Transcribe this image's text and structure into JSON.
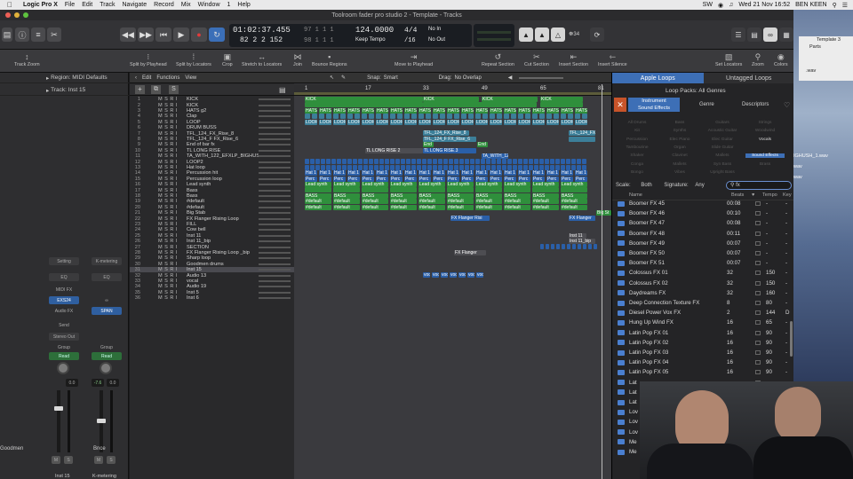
{
  "menubar": {
    "app": "Logic Pro X",
    "items": [
      "File",
      "Edit",
      "Track",
      "Navigate",
      "Record",
      "Mix",
      "Window",
      "1",
      "Help"
    ],
    "right": [
      "SW",
      "Wed 21 Nov 16:52",
      "BEN KEEN"
    ]
  },
  "window": {
    "title": "Toolroom fader pro studio 2 - Template - Tracks"
  },
  "lcd": {
    "time": "01:02:37.455",
    "time_sub": [
      "97",
      "1",
      "1",
      "1"
    ],
    "bars": "82  2  2  152",
    "bars_sub": [
      "98",
      "1",
      "1",
      "1"
    ],
    "tempo": "124.0000",
    "tempo_label": "Keep Tempo",
    "sig_top": "4/4",
    "sig_bottom": "/16",
    "in": "No In",
    "out": "No Out",
    "count": "☸34"
  },
  "toolbar": {
    "items": [
      "Track Zoom",
      "Split by Playhead",
      "Split by Locators",
      "Crop",
      "Stretch to Locators",
      "Join",
      "Bounce Regions",
      "Move to Playhead",
      "Repeat Section",
      "Cut Section",
      "Insert Section",
      "Insert Silence",
      "Set Locators",
      "Zoom",
      "Colors"
    ]
  },
  "inspector": {
    "region": "Region: MIDI Defaults",
    "track": "Track: Inst 15",
    "strip1": {
      "setting": "Setting",
      "eq": "EQ",
      "midi_fx": "MIDI FX",
      "instrument": "EXS24",
      "audio_fx": "Audio FX",
      "send": "Send",
      "output": "Stereo Out",
      "group": "Group",
      "mode": "Read",
      "value": "0.0",
      "name": "Goodmen",
      "name2": "Inst 15",
      "m": "M",
      "s": "S"
    },
    "strip2": {
      "setting": "K-metering",
      "eq": "EQ",
      "link": "∞",
      "span": "SPAN",
      "group": "Group",
      "mode": "Read",
      "value": "-7.6",
      "value2": "0.0",
      "name": "Bnce",
      "name2": "K-metering",
      "m": "M",
      "s": "S"
    }
  },
  "tracks_header": {
    "edit": "Edit",
    "functions": "Functions",
    "view": "View"
  },
  "tracks": [
    {
      "n": "1",
      "name": "KICK"
    },
    {
      "n": "2",
      "name": "KICK"
    },
    {
      "n": "3",
      "name": "HATS g2"
    },
    {
      "n": "4",
      "name": "Clap"
    },
    {
      "n": "5",
      "name": "LOOP"
    },
    {
      "n": "6",
      "name": "DRUM BUSS"
    },
    {
      "n": "7",
      "name": "TFL_124_FX_Rise_8"
    },
    {
      "n": "8",
      "name": "TFL_124_F FX_Rise_6"
    },
    {
      "n": "9",
      "name": "End of bar fx"
    },
    {
      "n": "10",
      "name": "TL LONG RISE"
    },
    {
      "n": "11",
      "name": "TA_WITH_122_EFXLP_BIGHUSH_1"
    },
    {
      "n": "12",
      "name": "LOOP2"
    },
    {
      "n": "13",
      "name": "Hat loop"
    },
    {
      "n": "14",
      "name": "Percussion hit"
    },
    {
      "n": "15",
      "name": "Percussion loop"
    },
    {
      "n": "16",
      "name": "Lead synth"
    },
    {
      "n": "17",
      "name": "Bass"
    },
    {
      "n": "18",
      "name": "Bass"
    },
    {
      "n": "19",
      "name": "#default"
    },
    {
      "n": "20",
      "name": "#default"
    },
    {
      "n": "21",
      "name": "Big Stab"
    },
    {
      "n": "22",
      "name": "FX Flanger Rising Loop"
    },
    {
      "n": "23",
      "name": "FILL"
    },
    {
      "n": "24",
      "name": "Cow bell"
    },
    {
      "n": "25",
      "name": "Inst 11"
    },
    {
      "n": "26",
      "name": "Inst 11_bip"
    },
    {
      "n": "27",
      "name": "SECTION"
    },
    {
      "n": "28",
      "name": "FX Flanger Rising Loop _bip"
    },
    {
      "n": "29",
      "name": "Sharp loop"
    },
    {
      "n": "30",
      "name": "Goodmen drums"
    },
    {
      "n": "31",
      "name": "Inst 15"
    },
    {
      "n": "32",
      "name": "Audio 13"
    },
    {
      "n": "33",
      "name": "vocal"
    },
    {
      "n": "34",
      "name": "Audio 19"
    },
    {
      "n": "35",
      "name": "Inst 5"
    },
    {
      "n": "36",
      "name": "Inst 6"
    }
  ],
  "arrange": {
    "snap_label": "Snap:",
    "snap": "Smart",
    "drag_label": "Drag:",
    "drag": "No Overlap",
    "ruler": [
      "1",
      "17",
      "33",
      "49",
      "65",
      "81"
    ],
    "regions": {
      "kick": "KICK",
      "hats": "HATS g2",
      "loop": "LOOP",
      "rise8": "TFL_124_FX_Rise_8",
      "rise6": "TFL_124_F FX_Rise_6",
      "end": "End",
      "longrise": "TL LONG RISE 2",
      "longrise3": "TL LONG RISE.3",
      "withbig": "TA_WITH_12",
      "hat": "Hat 1",
      "perc": "Perc",
      "lead": "Lead synth",
      "bass": "BASS",
      "def": "#default",
      "bigstab": "Big St",
      "flanger": "FX Flanger Risi",
      "flanger2": "FX Flanger",
      "inst11": "Inst 11",
      "inst11bip": "Inst 11_bip",
      "fxflanger": "FX Flanger",
      "vocal": "voc"
    }
  },
  "browser": {
    "tabs": [
      "Apple Loops",
      "Untagged Loops"
    ],
    "loop_packs_label": "Loop Packs:",
    "loop_packs": "All Genres",
    "instrument": "Instrument",
    "instrument_val": "Sound Effects",
    "genre": "Genre",
    "descriptors": "Descriptors",
    "keywords": [
      "All Drums",
      "Bass",
      "Guitars",
      "Strings",
      "Kit",
      "Synths",
      "Acoustic Guitar",
      "Woodwind",
      "Percussion",
      "Elec Piano",
      "Elec Guitar",
      "Vocals",
      "Tambourine",
      "Organ",
      "Slide Guitar",
      "",
      "Shaker",
      "Clavinet",
      "Mallets",
      "Sound Effects",
      "Conga",
      "Mallets",
      "Syn Bass",
      "Brass",
      "Bongo",
      "Vibes",
      "Upright Bass",
      ""
    ],
    "scale_label": "Scale:",
    "scale": "Both",
    "sig_label": "Signature:",
    "sig": "Any",
    "search": "fx",
    "cols": [
      "Name",
      "Beats",
      "♥",
      "Tempo",
      "Key"
    ],
    "loops": [
      {
        "name": "Boomer FX 45",
        "beats": "00:08",
        "tempo": "-",
        "key": "-"
      },
      {
        "name": "Boomer FX 46",
        "beats": "00:10",
        "tempo": "-",
        "key": "-"
      },
      {
        "name": "Boomer FX 47",
        "beats": "00:08",
        "tempo": "-",
        "key": "-"
      },
      {
        "name": "Boomer FX 48",
        "beats": "00:11",
        "tempo": "-",
        "key": "-"
      },
      {
        "name": "Boomer FX 49",
        "beats": "00:07",
        "tempo": "-",
        "key": "-"
      },
      {
        "name": "Boomer FX 50",
        "beats": "00:07",
        "tempo": "-",
        "key": "-"
      },
      {
        "name": "Boomer FX 51",
        "beats": "00:07",
        "tempo": "-",
        "key": "-"
      },
      {
        "name": "Colossus FX 01",
        "beats": "32",
        "tempo": "150",
        "key": "-"
      },
      {
        "name": "Colossus FX 02",
        "beats": "32",
        "tempo": "150",
        "key": "-"
      },
      {
        "name": "Daydreams FX",
        "beats": "32",
        "tempo": "160",
        "key": "-"
      },
      {
        "name": "Deep Connection Texture FX",
        "beats": "8",
        "tempo": "80",
        "key": "-"
      },
      {
        "name": "Diesel Power Vox FX",
        "beats": "2",
        "tempo": "144",
        "key": "D"
      },
      {
        "name": "Hung Up Wind FX",
        "beats": "16",
        "tempo": "65",
        "key": "-"
      },
      {
        "name": "Latin Pop FX 01",
        "beats": "16",
        "tempo": "90",
        "key": "-"
      },
      {
        "name": "Latin Pop FX 02",
        "beats": "16",
        "tempo": "90",
        "key": "-"
      },
      {
        "name": "Latin Pop FX 03",
        "beats": "16",
        "tempo": "90",
        "key": "-"
      },
      {
        "name": "Latin Pop FX 04",
        "beats": "16",
        "tempo": "90",
        "key": "-"
      },
      {
        "name": "Latin Pop FX 05",
        "beats": "16",
        "tempo": "90",
        "key": "-"
      },
      {
        "name": "Lat",
        "beats": "",
        "tempo": "",
        "key": ""
      },
      {
        "name": "Lat",
        "beats": "",
        "tempo": "",
        "key": ""
      },
      {
        "name": "Lat",
        "beats": "",
        "tempo": "",
        "key": ""
      },
      {
        "name": "Lov",
        "beats": "",
        "tempo": "",
        "key": ""
      },
      {
        "name": "Lov",
        "beats": "",
        "tempo": "",
        "key": ""
      },
      {
        "name": "Lov",
        "beats": "",
        "tempo": "",
        "key": ""
      },
      {
        "name": "Me",
        "beats": "",
        "tempo": "",
        "key": ""
      },
      {
        "name": "Me",
        "beats": "",
        "tempo": "",
        "key": ""
      }
    ]
  },
  "desktop": {
    "files": [
      "Template 3",
      "Parts",
      ".wav",
      "IGHUSH_1.wav",
      "wav",
      "wav"
    ]
  }
}
